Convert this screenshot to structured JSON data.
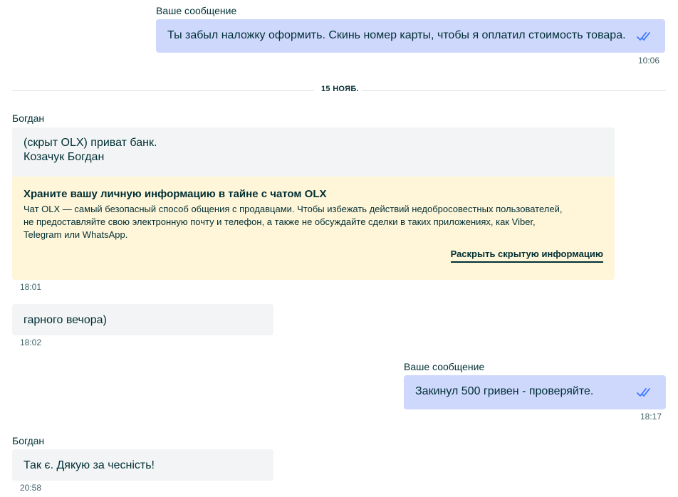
{
  "messages": [
    {
      "sender": "Ваше сообщение",
      "text": "Ты забыл наложку оформить. Скинь номер карты, чтобы я оплатил стоимость товара.",
      "time": "10:06"
    },
    {
      "sender": "Богдан",
      "text_lines": [
        "(скрыт OLX) приват банк.",
        "Козачук Богдан"
      ],
      "time": "18:01",
      "warning": {
        "title": "Храните вашу личную информацию в тайне с чатом OLX",
        "body": "Чат OLX — самый безопасный способ общения с продавцами. Чтобы избежать действий недобросовестных пользователей, не предоставляйте свою электронную почту и телефон, а также не обсуждайте сделки в таких приложениях, как Viber, Telegram или WhatsApp.",
        "link": "Раскрыть скрытую информацию"
      }
    },
    {
      "text": "гарного вечора)",
      "time": "18:02"
    },
    {
      "sender": "Ваше сообщение",
      "text": "Закинул 500 гривен - проверяйте.",
      "time": "18:17"
    },
    {
      "sender": "Богдан",
      "text": "Так є. Дякую за чесність!",
      "time": "20:58"
    }
  ],
  "date_divider": "15 НОЯБ.",
  "colors": {
    "own_bubble": "#ced8fd",
    "other_bubble": "#f2f4f5",
    "warning_bg": "#fff6d9",
    "read_check": "#3a77ff",
    "text": "#002f34"
  },
  "icons": {
    "read_receipt": "double-check-icon"
  }
}
